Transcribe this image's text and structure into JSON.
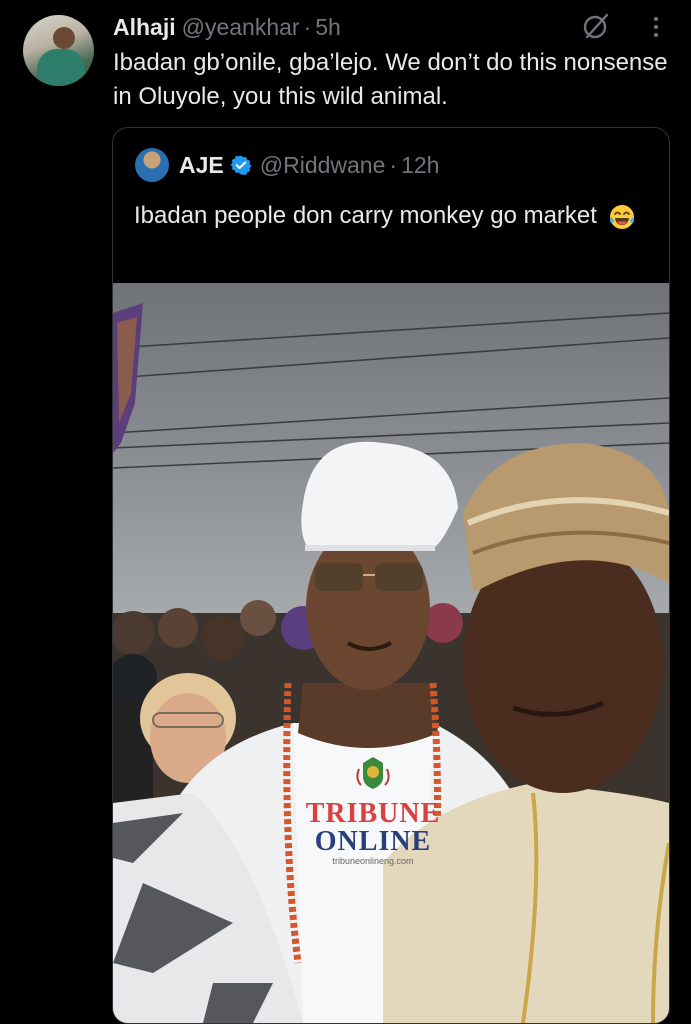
{
  "tweet": {
    "display_name": "Alhaji",
    "handle": "@yeankhar",
    "separator": "·",
    "time": "5h",
    "text": "Ibadan gb’onile, gba’lejo. We don’t do this nonsense in Oluyole, you this wild animal.",
    "icons": [
      "grok-icon",
      "more-icon"
    ]
  },
  "quoted": {
    "display_name": "AJE",
    "handle": "@Riddwane",
    "separator": "·",
    "time": "12h",
    "text": "Ibadan people don carry monkey go market",
    "emoji": "laughing-tears-emoji",
    "verified_color": "#1d9bf0"
  },
  "photo": {
    "watermark": {
      "line1": "TRIBUNE",
      "line2": "ONLINE",
      "url": "tribuneonlineng.com"
    }
  },
  "colors": {
    "background": "#000000",
    "text": "#e7e9ea",
    "secondary": "#71767b",
    "border": "#2f3336",
    "accent": "#1d9bf0"
  }
}
